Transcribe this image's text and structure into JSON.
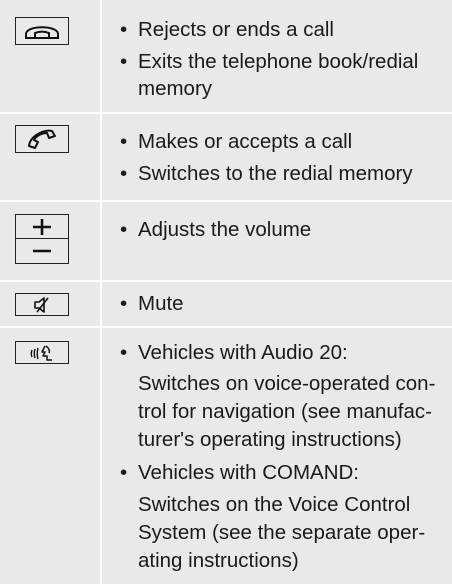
{
  "rows": [
    {
      "icon": "end-call-icon",
      "lines": [
        "• Rejects or ends a call",
        "• Exits the telephone book/redial",
        "memory"
      ]
    },
    {
      "icon": "accept-call-icon",
      "lines": [
        "• Makes or accepts a call",
        "• Switches to the redial memory"
      ]
    },
    {
      "icons": [
        "plus-icon",
        "minus-icon"
      ],
      "lines": [
        "• Adjusts the volume"
      ]
    },
    {
      "icon": "mute-icon",
      "lines": [
        "• Mute"
      ]
    },
    {
      "icon": "voice-control-icon",
      "lines": [
        "• Vehicles with Audio 20:",
        "Switches on voice-operated con-",
        "trol for navigation (see manufac-",
        "turer's operating instructions)",
        "• Vehicles with COMAND:",
        "Switches on the Voice Control",
        "System (see the separate oper-",
        "ating instructions)"
      ]
    }
  ],
  "bullet_mark": "•",
  "text": {
    "r1_b1": "Rejects or ends a call",
    "r1_b2": "Exits the telephone book/redial",
    "r1_b2_cont": "memory",
    "r2_b1": "Makes or accepts a call",
    "r2_b2": "Switches to the redial memory",
    "r3_b1": "Adjusts the volume",
    "r4_b1": "Mute",
    "r5_b1": "Vehicles with Audio 20:",
    "r5_b1_l2": "Switches on voice-operated con-",
    "r5_b1_l3": "trol for navigation (see manufac-",
    "r5_b1_l4": "turer's operating instructions)",
    "r5_b2": "Vehicles with COMAND:",
    "r5_b2_l2": "Switches on the Voice Control",
    "r5_b2_l3": "System (see the separate oper-",
    "r5_b2_l4": "ating instructions)"
  }
}
